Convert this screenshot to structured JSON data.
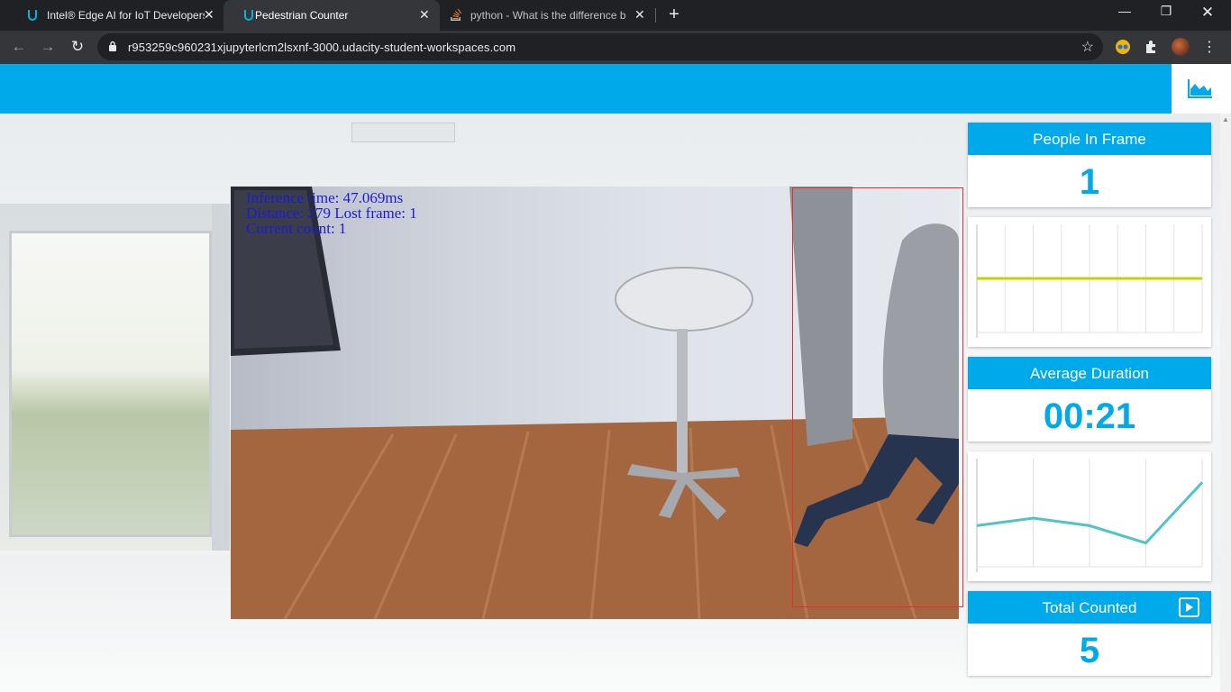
{
  "browser": {
    "tabs": [
      {
        "title": "Intel® Edge AI for IoT Developers",
        "active": false
      },
      {
        "title": "Pedestrian Counter",
        "active": true
      },
      {
        "title": "python - What is the difference b",
        "active": false
      }
    ],
    "url": "r953259c960231xjupyterlcm2lsxnf-3000.udacity-student-workspaces.com"
  },
  "video": {
    "osd_line1": "Inference time: 47.069ms",
    "osd_line2": "Distance: 279 Lost frame: 1",
    "osd_line3": "Current count: 1"
  },
  "panel": {
    "people": {
      "label": "People In Frame",
      "value": "1"
    },
    "duration": {
      "label": "Average Duration",
      "value": "00:21"
    },
    "total": {
      "label": "Total Counted",
      "value": "5"
    }
  },
  "colors": {
    "accent": "#00a9e9",
    "line_people": "#c7d300",
    "line_duration": "#4fc3c8"
  },
  "chart_people": {
    "type": "line",
    "values": [
      1,
      1
    ]
  },
  "chart_duration": {
    "type": "line",
    "values": [
      0.62,
      0.55,
      0.62,
      0.78,
      0.22
    ]
  }
}
